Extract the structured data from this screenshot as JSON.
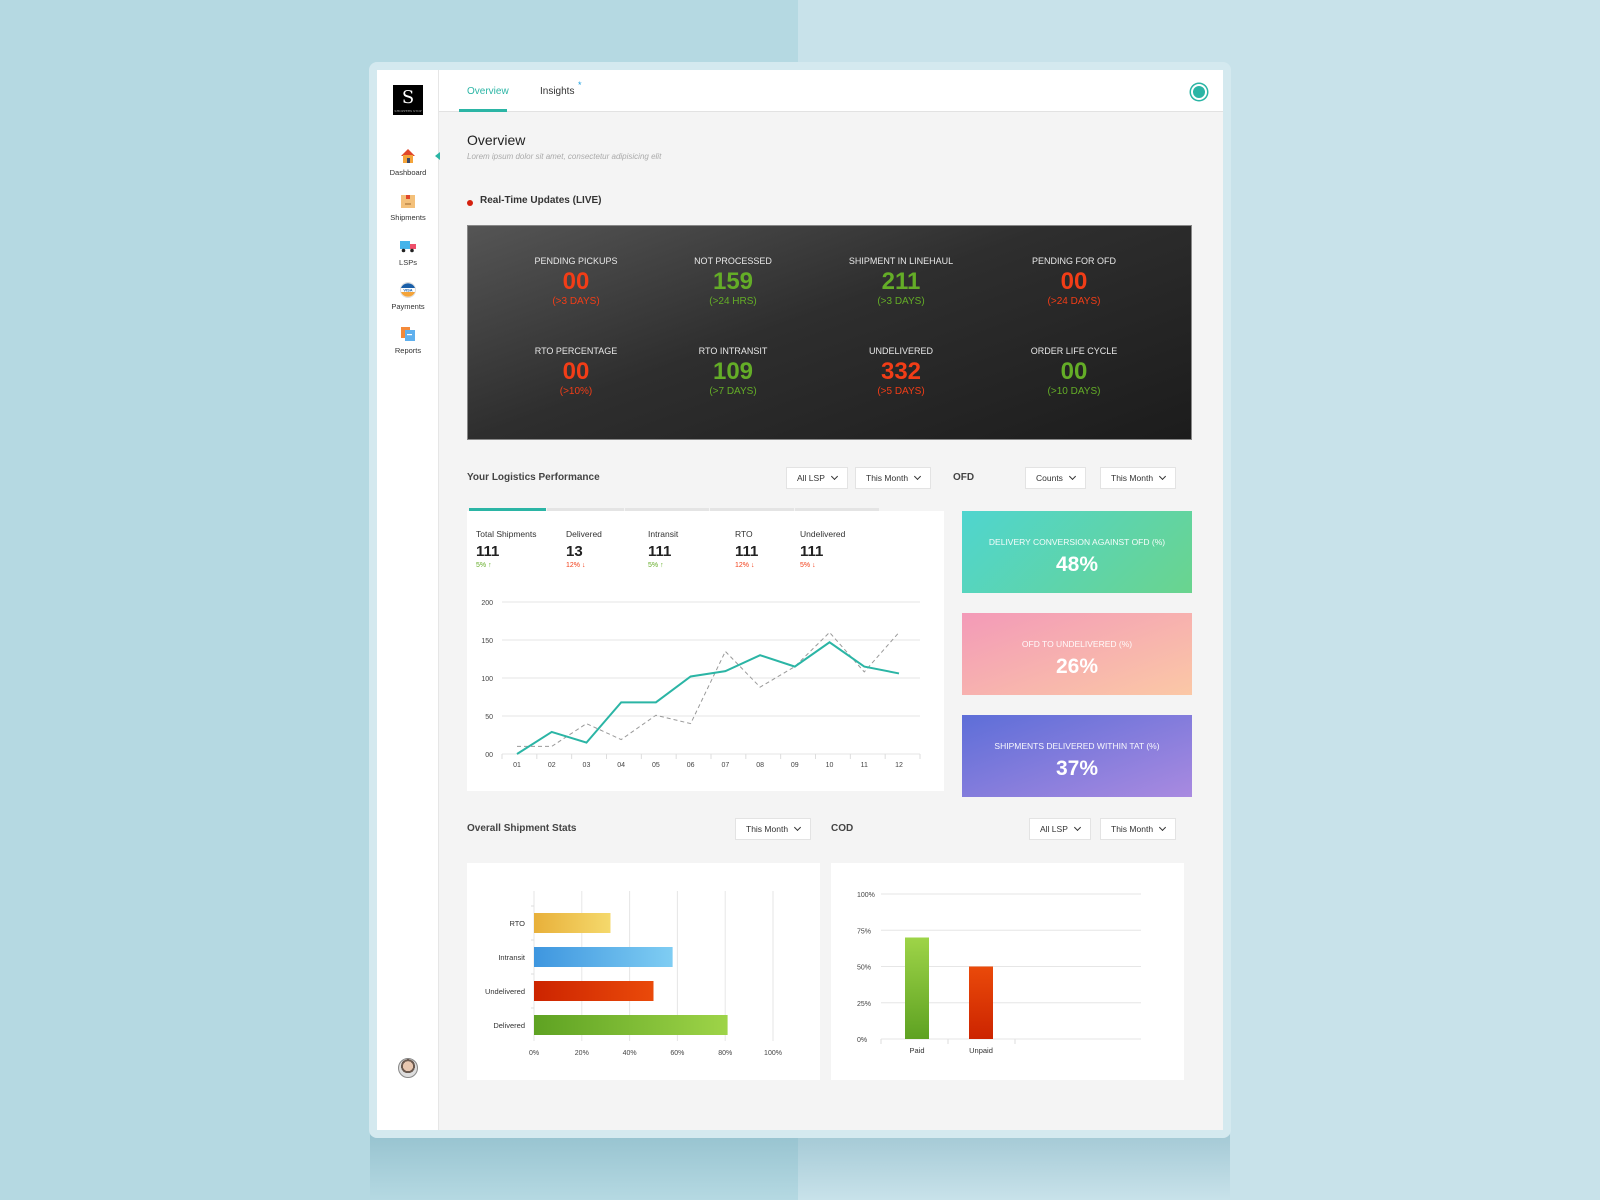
{
  "sidebar": {
    "logo_text": "S",
    "logo_subtext": "SHOPPERS STOP",
    "items": [
      {
        "label": "Dashboard",
        "icon": "house-icon",
        "active": true
      },
      {
        "label": "Shipments",
        "icon": "box-icon"
      },
      {
        "label": "LSPs",
        "icon": "truck-icon"
      },
      {
        "label": "Payments",
        "icon": "visa-card-icon"
      },
      {
        "label": "Reports",
        "icon": "documents-icon"
      }
    ],
    "avatar": "user-avatar"
  },
  "header": {
    "tabs": [
      {
        "label": "Overview",
        "active": true
      },
      {
        "label": "Insights",
        "badge": "*"
      }
    ],
    "status_icon": "online-status-icon"
  },
  "page": {
    "title": "Overview",
    "subtitle": "Lorem ipsum dolor sit amet, consectetur adipisicing elit"
  },
  "realtime": {
    "title": "Real-Time Updates (LIVE)",
    "cells": [
      {
        "label": "PENDING PICKUPS",
        "value": "00",
        "sub": "(>3 DAYS)",
        "status": "red"
      },
      {
        "label": "NOT PROCESSED",
        "value": "159",
        "sub": "(>24 HRS)",
        "status": "green"
      },
      {
        "label": "SHIPMENT IN LINEHAUL",
        "value": "211",
        "sub": "(>3 DAYS)",
        "status": "green"
      },
      {
        "label": "PENDING FOR OFD",
        "value": "00",
        "sub": "(>24 DAYS)",
        "status": "red"
      },
      {
        "label": "RTO PERCENTAGE",
        "value": "00",
        "sub": "(>10%)",
        "status": "red"
      },
      {
        "label": "RTO INTRANSIT",
        "value": "109",
        "sub": "(>7 DAYS)",
        "status": "green"
      },
      {
        "label": "UNDELIVERED",
        "value": "332",
        "sub": "(>5 DAYS)",
        "status": "red"
      },
      {
        "label": "ORDER LIFE CYCLE",
        "value": "00",
        "sub": "(>10 DAYS)",
        "status": "green"
      }
    ]
  },
  "colors": {
    "accent": "#2bb5a5",
    "red": "#f23d17",
    "green": "#64ad27"
  },
  "performance": {
    "title": "Your Logistics Performance",
    "filter_lsp": "All LSP",
    "filter_period": "This Month",
    "kpis": [
      {
        "label": "Total Shipments",
        "value": "111",
        "change": "5%",
        "dir": "up"
      },
      {
        "label": "Delivered",
        "value": "13",
        "change": "12%",
        "dir": "down"
      },
      {
        "label": "Intransit",
        "value": "111",
        "change": "5%",
        "dir": "up"
      },
      {
        "label": "RTO",
        "value": "111",
        "change": "12%",
        "dir": "down"
      },
      {
        "label": "Undelivered",
        "value": "111",
        "change": "5%",
        "dir": "down"
      }
    ]
  },
  "ofd": {
    "title": "OFD",
    "filter_metric": "Counts",
    "filter_period": "This Month",
    "cards": [
      {
        "label": "DELIVERY CONVERSION AGAINST OFD (%)",
        "value": "48%"
      },
      {
        "label": "OFD TO UNDELIVERED (%)",
        "value": "26%"
      },
      {
        "label": "SHIPMENTS DELIVERED WITHIN TAT (%)",
        "value": "37%"
      }
    ]
  },
  "shipment_stats": {
    "title": "Overall Shipment Stats",
    "filter_period": "This Month"
  },
  "cod": {
    "title": "COD",
    "filter_lsp": "All LSP",
    "filter_period": "This Month"
  },
  "chart_data": [
    {
      "type": "line",
      "title": "Your Logistics Performance",
      "x": [
        "01",
        "02",
        "03",
        "04",
        "05",
        "06",
        "07",
        "08",
        "09",
        "10",
        "11",
        "12"
      ],
      "yticks": [
        "00",
        "50",
        "100",
        "150",
        "200"
      ],
      "ylim": [
        0,
        200
      ],
      "grid": true,
      "series": [
        {
          "name": "current",
          "style": "solid",
          "color": "#2bb5a5",
          "values": [
            0,
            29,
            15,
            68,
            68,
            102,
            109,
            130,
            115,
            147,
            115,
            106
          ]
        },
        {
          "name": "previous",
          "style": "dashed",
          "color": "#999999",
          "values": [
            10,
            10,
            40,
            19,
            51,
            40,
            135,
            88,
            115,
            160,
            108,
            160
          ]
        }
      ]
    },
    {
      "type": "bar",
      "orientation": "horizontal",
      "title": "Overall Shipment Stats",
      "categories": [
        "RTO",
        "Intransit",
        "Undelivered",
        "Delivered"
      ],
      "values": [
        32,
        58,
        50,
        81
      ],
      "colors": [
        [
          "#e8b03a",
          "#f5d96c"
        ],
        [
          "#3e96df",
          "#7fcdf3"
        ],
        [
          "#cc2400",
          "#ea4a0a"
        ],
        [
          "#5ea222",
          "#9ed448"
        ]
      ],
      "xticks": [
        "0%",
        "20%",
        "40%",
        "60%",
        "80%",
        "100%"
      ],
      "xlim": [
        0,
        100
      ],
      "grid": true
    },
    {
      "type": "bar",
      "title": "COD",
      "categories": [
        "Paid",
        "Unpaid"
      ],
      "values": [
        70,
        50
      ],
      "colors": [
        [
          "#9ed448",
          "#5ea222"
        ],
        [
          "#ea4a0a",
          "#cc2400"
        ]
      ],
      "yticks": [
        "0%",
        "25%",
        "50%",
        "75%",
        "100%"
      ],
      "ylim": [
        0,
        100
      ],
      "grid": true
    }
  ]
}
